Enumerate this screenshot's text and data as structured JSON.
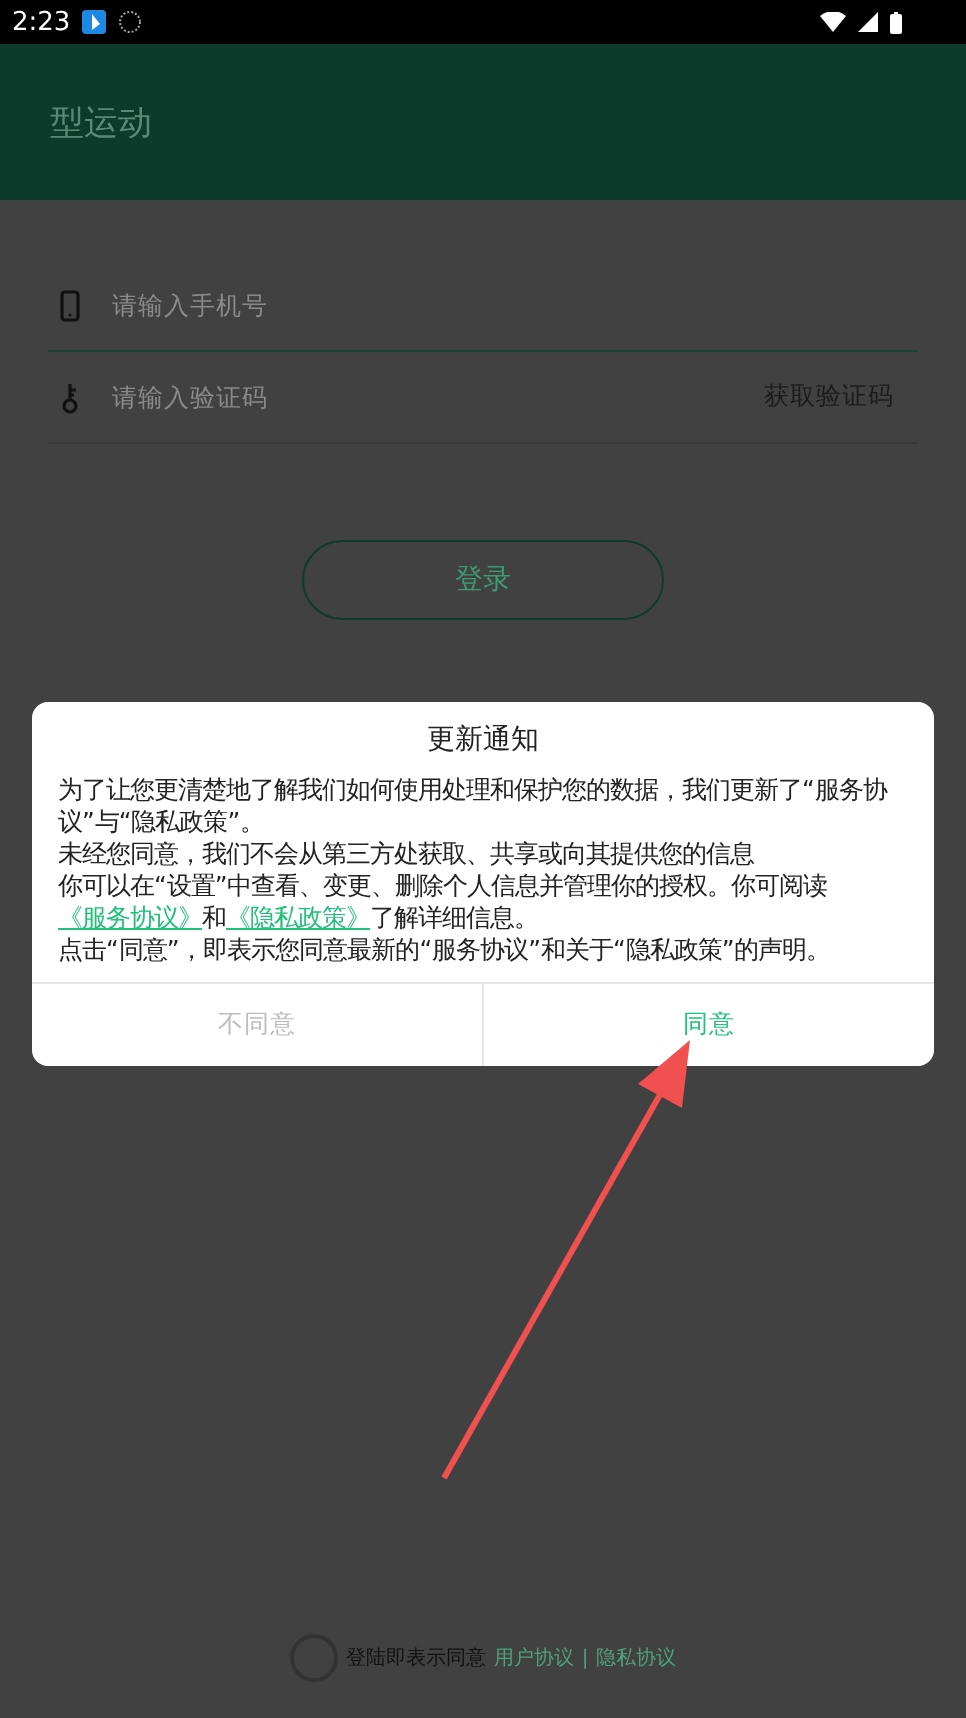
{
  "status_bar": {
    "time": "2:23"
  },
  "header": {
    "title": "型运动"
  },
  "form": {
    "phone_placeholder": "请输入手机号",
    "code_placeholder": "请输入验证码",
    "get_code": "获取验证码",
    "login": "登录"
  },
  "dialog": {
    "title": "更新通知",
    "paragraphs": [
      [
        {
          "text": "为了让您更清楚地了解我们如何使用处理和保护您的数据，我们更新了“服务协议”与“隐私政策”。",
          "kind": "text"
        }
      ],
      [
        {
          "text": "未经您同意，我们不会从第三方处获取、共享或向其提供您的信息",
          "kind": "text"
        }
      ],
      [
        {
          "text": "你可以在“设置”中查看、变更、删除个人信息并管理你的授权。你可阅读",
          "kind": "text"
        },
        {
          "text": "《服务协议》",
          "kind": "link"
        },
        {
          "text": "和",
          "kind": "text"
        },
        {
          "text": "《隐私政策》",
          "kind": "link"
        },
        {
          "text": "了解详细信息。",
          "kind": "text"
        }
      ],
      [
        {
          "text": "点击“同意”，即表示您同意最新的“服务协议”和关于“隐私政策”的声明。",
          "kind": "text"
        }
      ]
    ],
    "buttons": [
      {
        "label": "不同意",
        "kind": "decline"
      },
      {
        "label": "同意",
        "kind": "accept"
      }
    ]
  },
  "footer": {
    "agree_checked": false,
    "text": "登陆即表示同意",
    "user_agreement": "用户协议",
    "separator": "|",
    "privacy": "隐私协议"
  }
}
